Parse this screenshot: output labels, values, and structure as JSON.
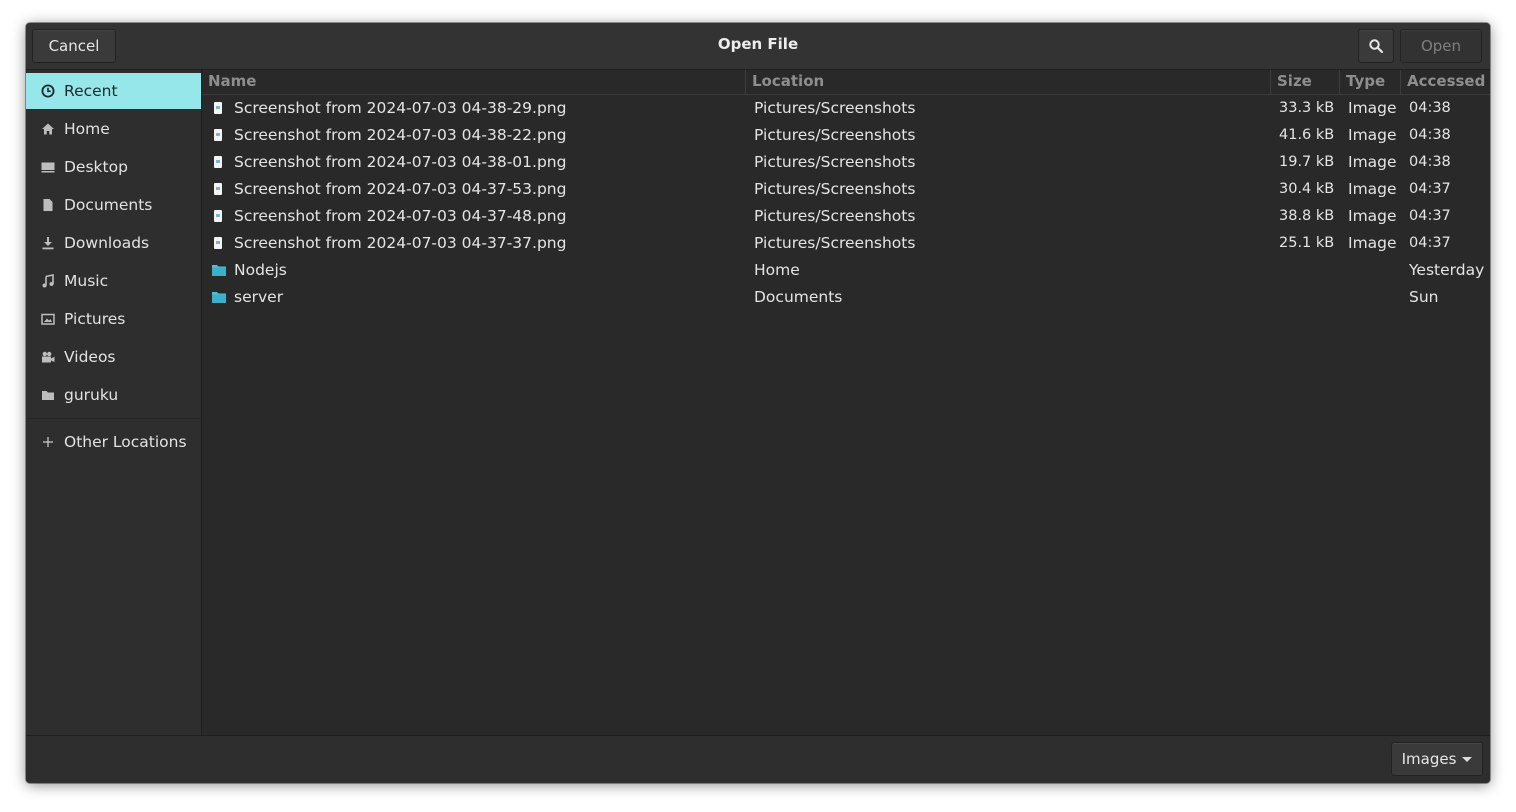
{
  "header": {
    "title": "Open File",
    "cancel_label": "Cancel",
    "open_label": "Open",
    "search_icon": "search-icon"
  },
  "sidebar": {
    "items": [
      {
        "label": "Recent",
        "icon": "clock-icon",
        "active": true
      },
      {
        "label": "Home",
        "icon": "home-icon"
      },
      {
        "label": "Desktop",
        "icon": "desktop-icon"
      },
      {
        "label": "Documents",
        "icon": "document-icon"
      },
      {
        "label": "Downloads",
        "icon": "download-icon"
      },
      {
        "label": "Music",
        "icon": "music-icon"
      },
      {
        "label": "Pictures",
        "icon": "pictures-icon"
      },
      {
        "label": "Videos",
        "icon": "video-icon"
      },
      {
        "label": "guruku",
        "icon": "folder-icon"
      }
    ],
    "other_locations": {
      "label": "Other Locations",
      "icon": "plus-icon"
    }
  },
  "columns": {
    "name": "Name",
    "location": "Location",
    "size": "Size",
    "type": "Type",
    "accessed": "Accessed"
  },
  "files": [
    {
      "name": "Screenshot from 2024-07-03 04-38-29.png",
      "location": "Pictures/Screenshots",
      "size": "33.3 kB",
      "type": "Image",
      "accessed": "04:38",
      "icon": "image-file-icon"
    },
    {
      "name": "Screenshot from 2024-07-03 04-38-22.png",
      "location": "Pictures/Screenshots",
      "size": "41.6 kB",
      "type": "Image",
      "accessed": "04:38",
      "icon": "image-file-icon"
    },
    {
      "name": "Screenshot from 2024-07-03 04-38-01.png",
      "location": "Pictures/Screenshots",
      "size": "19.7 kB",
      "type": "Image",
      "accessed": "04:38",
      "icon": "image-file-icon"
    },
    {
      "name": "Screenshot from 2024-07-03 04-37-53.png",
      "location": "Pictures/Screenshots",
      "size": "30.4 kB",
      "type": "Image",
      "accessed": "04:37",
      "icon": "image-file-icon"
    },
    {
      "name": "Screenshot from 2024-07-03 04-37-48.png",
      "location": "Pictures/Screenshots",
      "size": "38.8 kB",
      "type": "Image",
      "accessed": "04:37",
      "icon": "image-file-icon"
    },
    {
      "name": "Screenshot from 2024-07-03 04-37-37.png",
      "location": "Pictures/Screenshots",
      "size": "25.1 kB",
      "type": "Image",
      "accessed": "04:37",
      "icon": "image-file-icon"
    },
    {
      "name": "Nodejs",
      "location": "Home",
      "size": "",
      "type": "",
      "accessed": "Yesterday",
      "icon": "folder-icon"
    },
    {
      "name": "server",
      "location": "Documents",
      "size": "",
      "type": "",
      "accessed": "Sun",
      "icon": "folder-icon"
    }
  ],
  "footer": {
    "filter_label": "Images"
  },
  "colors": {
    "accent": "#95e7ea",
    "folder": "#4fbfd6",
    "background": "#292929"
  }
}
